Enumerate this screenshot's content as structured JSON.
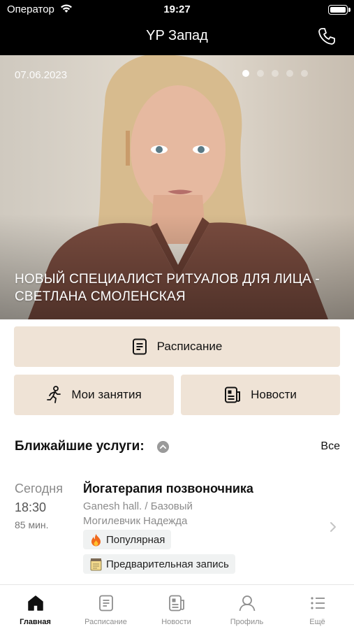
{
  "status_bar": {
    "carrier": "Оператор",
    "time": "19:27"
  },
  "header": {
    "title": "YP Запад"
  },
  "banner": {
    "date": "07.06.2023",
    "title": "НОВЫЙ СПЕЦИАЛИСТ РИТУАЛОВ ДЛЯ ЛИЦА - СВЕТЛАНА СМОЛЕНСКАЯ",
    "slide_count": 5,
    "active_slide": 1
  },
  "actions": {
    "schedule": "Расписание",
    "my_classes": "Мои занятия",
    "news": "Новости"
  },
  "upcoming": {
    "title": "Ближайшие услуги:",
    "all_label": "Все",
    "items": [
      {
        "day": "Сегодня",
        "time": "18:30",
        "duration": "85 мин.",
        "name": "Йогатерапия позвоночника",
        "hall": "Ganesh hall. / Базовый",
        "coach": "Могилевчик Надежда",
        "tags": [
          {
            "icon": "fire-icon",
            "label": "Популярная"
          },
          {
            "icon": "notepad-icon",
            "label": "Предварительная запись"
          }
        ]
      }
    ]
  },
  "tabbar": {
    "tabs": [
      {
        "label": "Главная",
        "icon": "home-icon",
        "active": true
      },
      {
        "label": "Расписание",
        "icon": "schedule-icon",
        "active": false
      },
      {
        "label": "Новости",
        "icon": "news-icon",
        "active": false
      },
      {
        "label": "Профиль",
        "icon": "profile-icon",
        "active": false
      },
      {
        "label": "Ещё",
        "icon": "list-icon",
        "active": false
      }
    ]
  },
  "colors": {
    "header_bg": "#000000",
    "button_bg": "#efe3d6",
    "tag_bg": "#f0f2f2"
  }
}
